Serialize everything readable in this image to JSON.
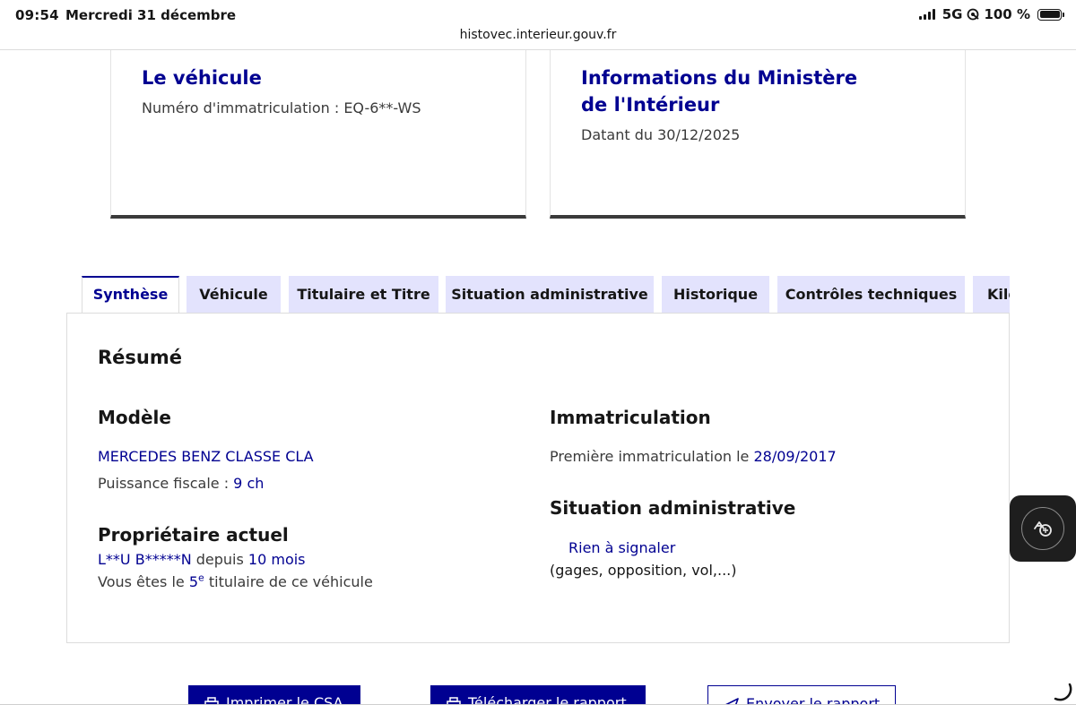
{
  "status_bar": {
    "time": "09:54",
    "date": "Mercredi 31 décembre",
    "network": "5G",
    "battery": "100 %"
  },
  "browser": {
    "url": "histovec.interieur.gouv.fr"
  },
  "cards": {
    "vehicle": {
      "title": "Le véhicule",
      "registration": "Numéro d'immatriculation : EQ-6**-WS"
    },
    "ministry": {
      "title": "Informations du Ministère de l'Intérieur",
      "date": "Datant du 30/12/2025"
    }
  },
  "tabs": [
    {
      "label": "Synthèse",
      "active": true
    },
    {
      "label": "Véhicule",
      "active": false
    },
    {
      "label": "Titulaire et Titre",
      "active": false
    },
    {
      "label": "Situation administrative",
      "active": false
    },
    {
      "label": "Historique",
      "active": false
    },
    {
      "label": "Contrôles techniques",
      "active": false
    },
    {
      "label": "Kilométrage",
      "active": false
    }
  ],
  "summary": {
    "title": "Résumé",
    "model": {
      "heading": "Modèle",
      "name": "MERCEDES BENZ CLASSE CLA",
      "fiscal_power_label": "Puissance fiscale : ",
      "fiscal_power_value": "9 ch"
    },
    "owner": {
      "heading": "Propriétaire actuel",
      "name": "L**U B*****N",
      "since_label": " depuis ",
      "since_value": "10 mois",
      "rank_prefix": "Vous êtes le ",
      "rank_number": "5",
      "rank_sup": "e",
      "rank_suffix": " titulaire de ce véhicule"
    },
    "registration": {
      "heading": "Immatriculation",
      "first_label": "Première immatriculation le ",
      "first_date": "28/09/2017"
    },
    "admin": {
      "heading": "Situation administrative",
      "status": "Rien à signaler",
      "details": "(gages, opposition, vol,...)"
    }
  },
  "actions": {
    "print": "Imprimer le CSA",
    "download": "Télécharger le rapport",
    "send": "Envoyer le rapport"
  },
  "colors": {
    "primary": "#000091",
    "tab_background": "#e3e3fd",
    "text": "#161616",
    "muted_text": "#3a3a3a"
  },
  "icons": {
    "floating_button": "translate-icon",
    "print": "printer-icon",
    "download": "download-icon",
    "send": "send-icon"
  }
}
